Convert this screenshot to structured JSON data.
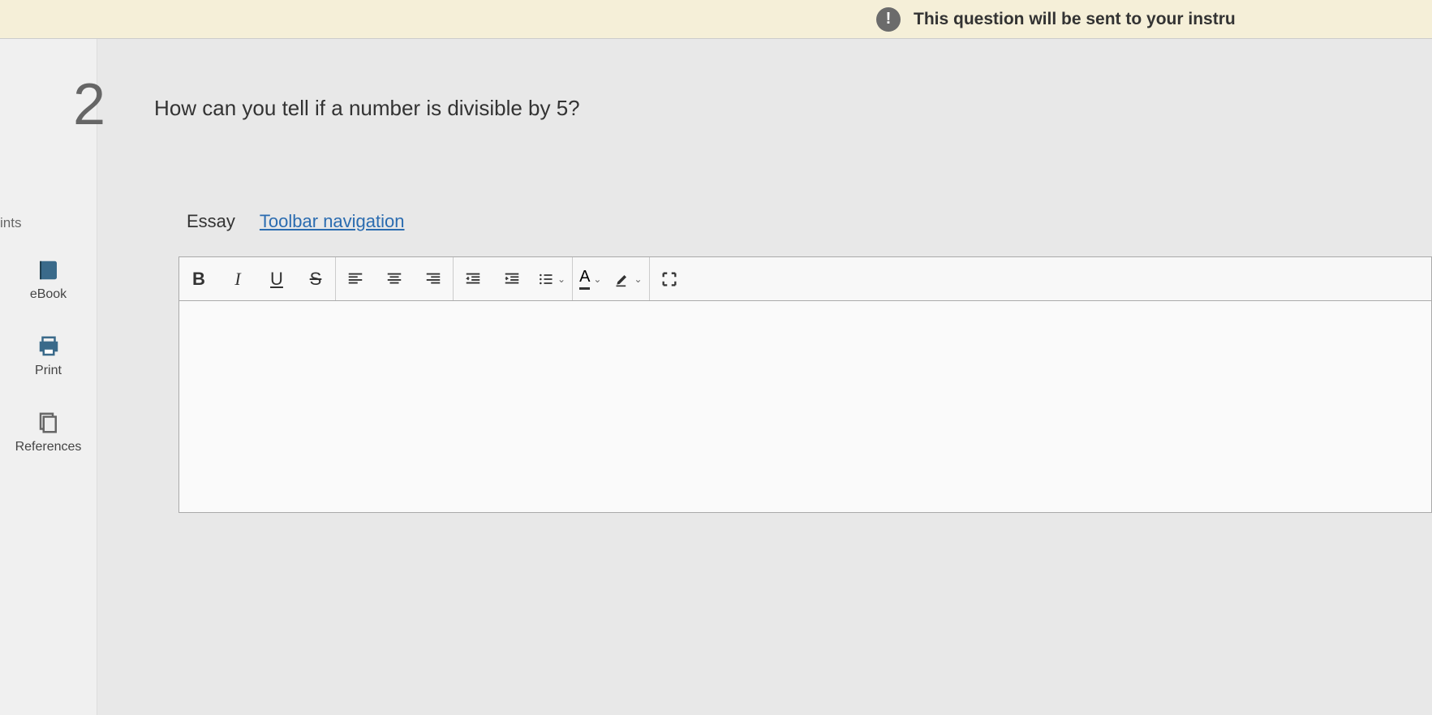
{
  "notification": {
    "text": "This question will be sent to your instru"
  },
  "question": {
    "number": "2",
    "text": "How can you tell if a number is divisible by 5?"
  },
  "sidebar": {
    "hints_label": "ints",
    "items": [
      {
        "label": "eBook"
      },
      {
        "label": "Print"
      },
      {
        "label": "References"
      }
    ]
  },
  "editor": {
    "type_label": "Essay",
    "toolbar_nav": "Toolbar navigation",
    "buttons": {
      "bold": "B",
      "italic": "I",
      "underline": "U",
      "strike": "S",
      "text_color": "A"
    }
  }
}
